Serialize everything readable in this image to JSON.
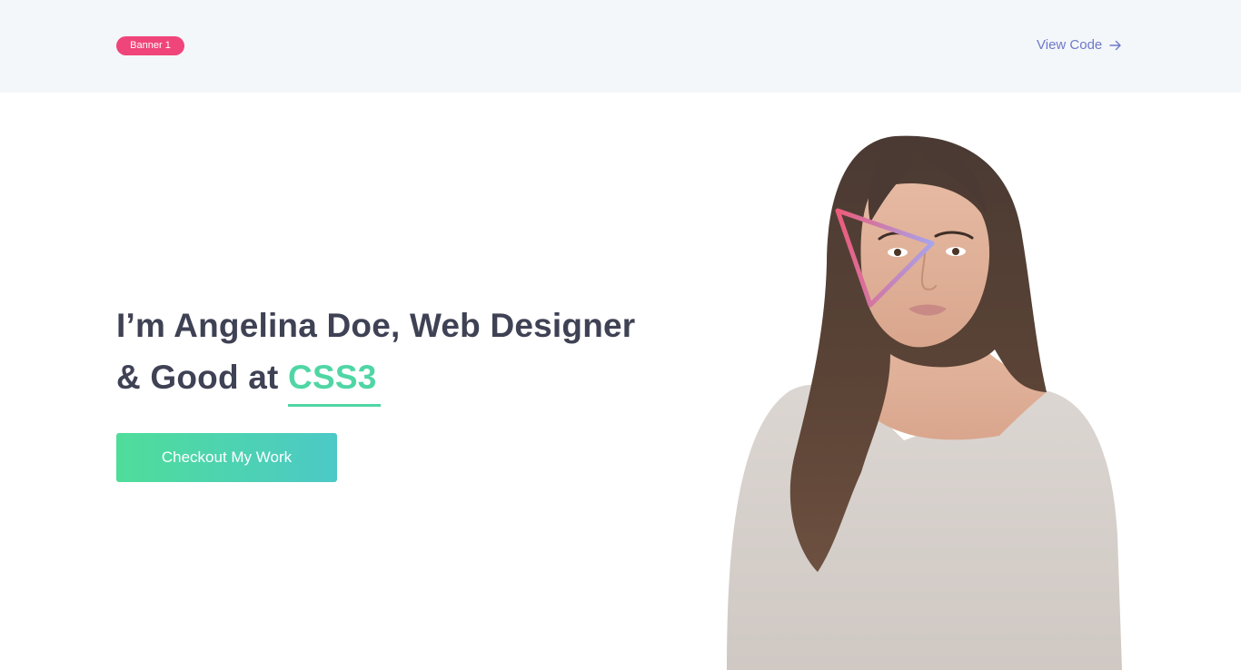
{
  "topbar": {
    "badge_label": "Banner 1",
    "view_code_label": "View Code"
  },
  "hero": {
    "title_line1": "I’m Angelina Doe, Web Designer",
    "title_line2_prefix": "& Good at ",
    "title_accent": "CSS3",
    "cta_label": "Checkout My Work"
  },
  "colors": {
    "badge": "#f0457a",
    "link": "#6f78c9",
    "heading": "#3f4254",
    "accent": "#4fd6a4",
    "cta_gradient_start": "#4fdd9a",
    "cta_gradient_end": "#4cc9c6",
    "topbar_bg": "#f4f7fa"
  },
  "icons": {
    "view_code": "arrow-right-icon",
    "decoration": "triangle-outline-icon"
  }
}
